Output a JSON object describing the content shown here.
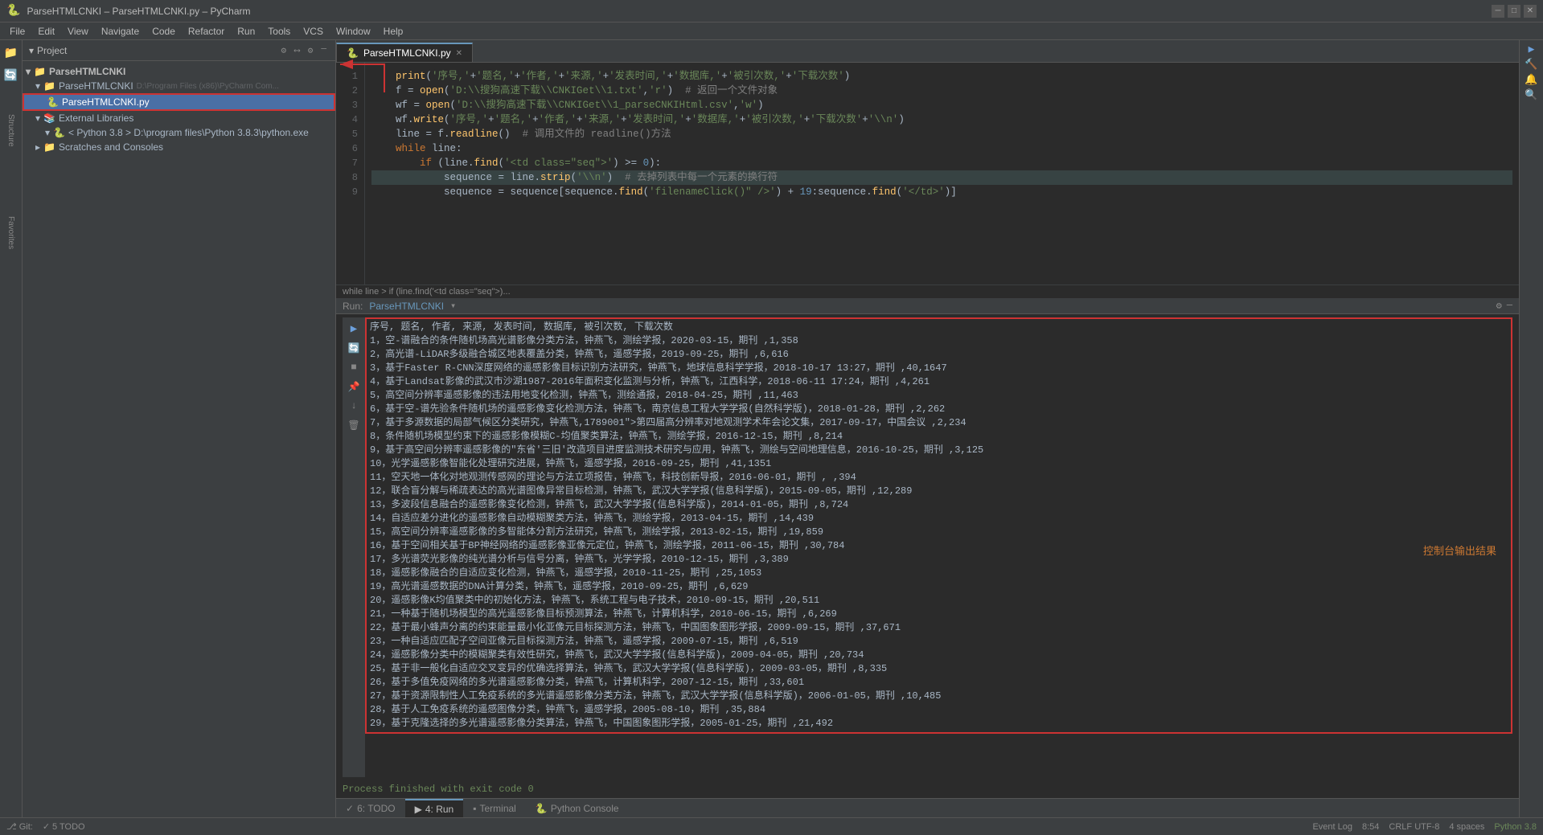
{
  "titleBar": {
    "title": "ParseHTMLCNKI – ParseHTMLCNKI.py – PyCharm",
    "minimize": "─",
    "maximize": "□",
    "close": "✕"
  },
  "menuBar": {
    "items": [
      "File",
      "Edit",
      "View",
      "Navigate",
      "Code",
      "Refactor",
      "Run",
      "Tools",
      "VCS",
      "Window",
      "Help"
    ]
  },
  "projectPanel": {
    "title": "Project",
    "actions": [
      "⚙",
      "⟷",
      "⚙",
      "─"
    ],
    "tree": [
      {
        "level": "root",
        "icon": "▾",
        "label": "ParseHTMLCNKI"
      },
      {
        "level": "level1",
        "icon": "▾",
        "label": "ParseHTMLCNKI",
        "path": "D:\\Program Files (x86)\\PyCharm Com..."
      },
      {
        "level": "level2",
        "icon": "📄",
        "label": "ParseHTMLCNKI.py",
        "highlighted": true
      },
      {
        "level": "level1",
        "icon": "▾",
        "label": "External Libraries"
      },
      {
        "level": "level2",
        "icon": "▾",
        "label": "< Python 3.8 > D:\\program files\\Python 3.8.3\\python.exe"
      },
      {
        "level": "level1",
        "icon": "📁",
        "label": "Scratches and Consoles"
      }
    ]
  },
  "editorTab": {
    "label": "ParseHTMLCNKI.py",
    "icon": "🐍"
  },
  "codeLines": [
    {
      "num": 1,
      "text": "    print('序号,'+' 题名,'+' 作者,'+' 来源,'+' 发表时间,'+' 数据库,'+' 被引次数,'+' 下载次数')"
    },
    {
      "num": 2,
      "text": "    f = open('D:\\\\搜狗高速下载\\\\CNKIGet\\\\1.txt','r')  # 返回一个文件对象"
    },
    {
      "num": 3,
      "text": "    wf = open('D:\\\\搜狗高速下载\\\\CNKIGet\\\\1_parseCNKIHtml.csv','w')"
    },
    {
      "num": 4,
      "text": "    wf.write('序号,'+' 题名,'+' 作者,'+' 来源,'+' 发表时间,'+' 数据库,'+' 被引次数,'+' 下载次数'+'\\n')"
    },
    {
      "num": 5,
      "text": "    line = f.readline()  # 调用文件的 readline()方法"
    },
    {
      "num": 6,
      "text": "    while line:"
    },
    {
      "num": 7,
      "text": "        if (line.find('<td class=\"seq\">') >= 0):"
    },
    {
      "num": 8,
      "text": "            sequence = line.strip('\\n')  # 去掉列表中每一个元素的换行符"
    },
    {
      "num": 9,
      "text": "            sequence = sequence[sequence.find('filenameClick()\" />') + 19:sequence.find('</td>')]"
    }
  ],
  "breadcrumb": {
    "text": "while line  >  if (line.find('<td class=\"seq\">)..."
  },
  "runPanel": {
    "runLabel": "Run:",
    "fileName": "ParseHTMLCNKI",
    "settingsIcon": "⚙",
    "pinIcon": "📌"
  },
  "outputLines": [
    "序号, 题名, 作者, 来源, 发表时间, 数据库, 被引次数, 下载次数",
    "1, 空-谱融合的条件随机场高光谱影像分类方法，钟燕飞，测绘学报，2020-03-15，期刊 ,1,358",
    "2, 高光谱-LiDAR多级融合城区地表覆盖分类，钟燕飞，遥感学报，2019-09-25，期刊 ,6,616",
    "3, 基于Faster R-CNN深度网络的遥感影像目标识别方法研究，钟燕飞，地球信息科学学报，2018-10-17 13:27，期刊 ,40,1647",
    "4, 基于Landsat影像的武汉市沙湖1987-2016年面积变化监测与分析，钟燕飞，江西科学，2018-06-11 17:24，期刊 ,4,261",
    "5, 高空间分辨率遥感影像的违法用地变化检测，钟燕飞，测绘通报，2018-04-25，期刊 ,11,463",
    "6, 基于空-谱先验条件随机场的遥感影像变化检测方法，钟燕飞，南京信息工程大学学报(自然科学版)，2018-01-28，期刊 ,2,262",
    "7, 基于多源数据的局部气候区分类研究，钟燕飞,1789001\">第四届高分辨率对地观测学术年会论文集，2017-09-17，中国会议 ,2,234",
    "8, 条件随机场模型约束下的遥感影像模糊C-均值聚类算法，钟燕飞，测绘学报，2016-12-15，期刊 ,8,214",
    "9, 基于高空间分辨率遥感影像的\"东省'三旧'改造项目进度监测技术研究与应用，钟燕飞，测绘与空间地理信息，2016-10-25，期刊 ,3,125",
    "10, 光学遥感影像智能化处理研究进展，钟燕飞，遥感学报，2016-09-25，期刊 ,41,1351",
    "11, 空天地一体化对地观测传感网的理论与方法立项报告，钟燕飞，科技创新导报，2016-06-01，期刊 , ,394",
    "12, 联合盲分解与稀疏表达的高光谱图像异常目标检测，钟燕飞，武汉大学学报(信息科学版)，2015-09-05，期刊 ,12,289",
    "13, 多波段信息融合的遥感影像变化检测，钟燕飞，武汉大学学报(信息科学版)，2014-01-05，期刊 ,8,724",
    "14, 自适应差分进化的遥感影像自动模糊聚类方法，钟燕飞，测绘学报，2013-04-15，期刊 ,14,439",
    "15, 高空间分辨率遥感影像的多智能体分割方法研究，钟燕飞，测绘学报，2013-02-15，期刊 ,19,859",
    "16, 基于空间相关基于BP神经网络的遥感影像亚像元定位，钟燕飞，测绘学报，2011-06-15，期刊 ,30,784",
    "17, 多光谱荧光影像的纯光谱分析与信号分离，钟燕飞，光学学报，2010-12-15，期刊 ,3,389",
    "18, 遥感影像融合的自适应变化检测，钟燕飞，遥感学报，2010-11-25，期刊 ,25,1053",
    "19, 高光谱遥感数据的DNA计算分类，钟燕飞，遥感学报，2010-09-25，期刊 ,6,629",
    "20, 遥感影像K均值聚类中的初始化方法，钟燕飞，系统工程与电子技术，2010-09-15，期刊 ,20,511",
    "21, 一种基于随机场模型的高光遥感影像目标预测算法，钟燕飞，计算机科学，2010-06-15，期刊 ,6,269",
    "22, 基于最小蜂声分离的约束能量最小化亚像元目标探测方法，钟燕飞，中国图象图形学报，2009-09-15，期刊 ,37,671",
    "23, 一种自适应匹配子空间亚像元目标探测方法，钟燕飞，遥感学报，2009-07-15，期刊 ,6,519",
    "24, 遥感影像分类中的模糊聚类有效性研究，钟燕飞，武汉大学学报(信息科学版)，2009-04-05，期刊 ,20,734",
    "25, 基于非一般化自适应交叉变异的优确选择算法，钟燕飞，武汉大学学报(信息科学版)，2009-03-05，期刊 ,8,335",
    "26, 基于多值免疫网络的多光谱遥感影像分类，钟燕飞，计算机科学，2007-12-15，期刊 ,33,601",
    "27, 基于资源限制性人工免疫系统的多光谱遥感影像分类方法，钟燕飞，武汉大学学报(信息科学版)，2006-01-05，期刊 ,10,485",
    "28, 基于人工免疫系统的遥感图像分类，钟燕飞，遥感学报，2005-08-10，期刊 ,35,884",
    "29, 基于克隆选择的多光谱遥感影像分类算法，钟燕飞，中国图象图形学报，2005-01-25，期刊 ,21,492"
  ],
  "processLine": "Process finished with exit code 0",
  "annotationLabel": "控制台输出结果",
  "bottomTabs": [
    {
      "label": "6: TODO",
      "icon": "✓",
      "active": false
    },
    {
      "label": "4: Run",
      "icon": "▶",
      "active": true
    },
    {
      "label": "Terminal",
      "icon": "▪",
      "active": false
    },
    {
      "label": "Python Console",
      "icon": "🐍",
      "active": false
    }
  ],
  "statusBar": {
    "gitBranch": "Git: 5 TODO",
    "line": "8:54",
    "encoding": "CRLF  UTF-8",
    "spaces": "4 spaces",
    "pythonVersion": "Python 3.8",
    "eventLog": "Event Log"
  },
  "runConfig": {
    "label": "ParseHTMLCNKI",
    "runIcon": "▶",
    "buildIcon": "🔨"
  }
}
